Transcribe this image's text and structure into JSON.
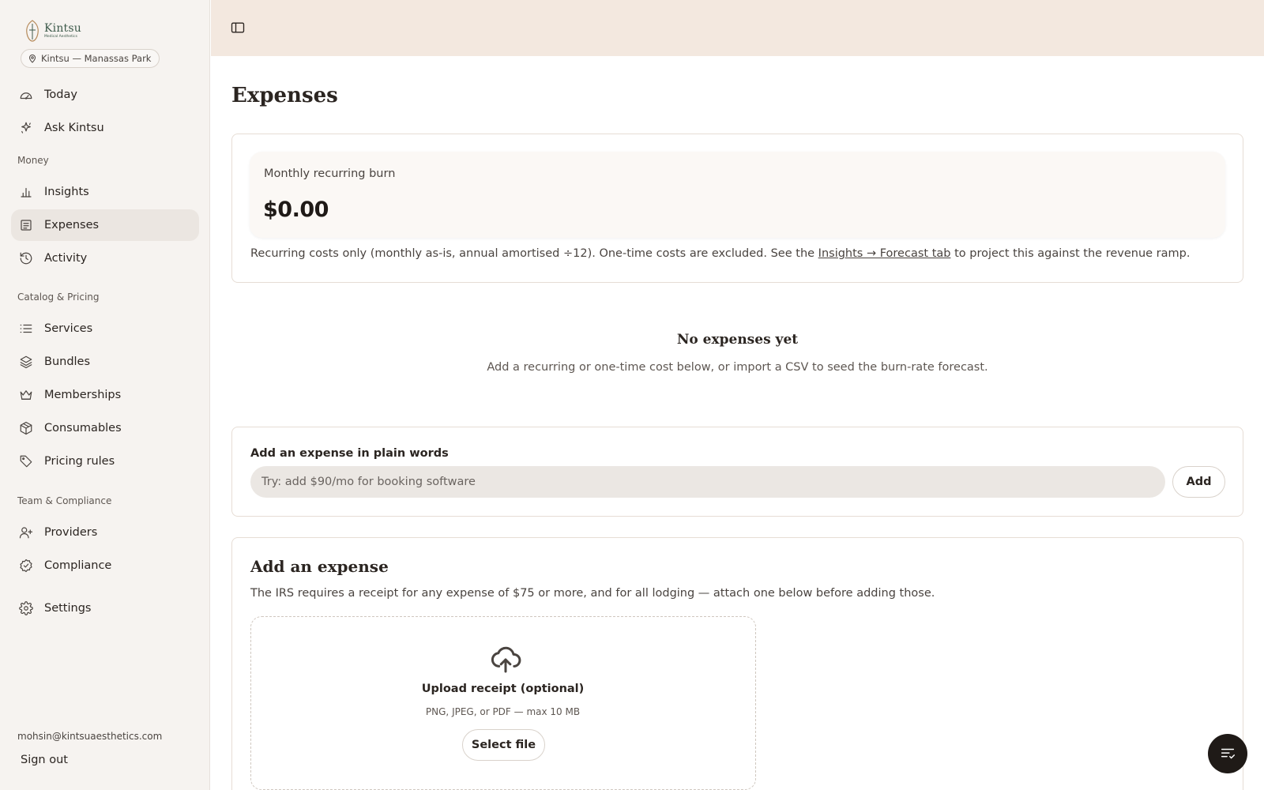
{
  "brand": {
    "name": "Kintsu",
    "subtitle": "Medical Aesthetics",
    "accent": "#3d5a4a"
  },
  "location": {
    "label": "Kintsu — Manassas Park",
    "icon": "map-pin-icon"
  },
  "sidebar": {
    "top_items": [
      {
        "label": "Today",
        "icon": "gauge-icon"
      },
      {
        "label": "Ask Kintsu",
        "icon": "sparkle-icon"
      }
    ],
    "sections": [
      {
        "title": "Money",
        "items": [
          {
            "label": "Insights",
            "icon": "bar-chart-icon"
          },
          {
            "label": "Expenses",
            "icon": "receipt-icon",
            "active": true
          },
          {
            "label": "Activity",
            "icon": "history-icon"
          }
        ]
      },
      {
        "title": "Catalog & Pricing",
        "items": [
          {
            "label": "Services",
            "icon": "list-icon"
          },
          {
            "label": "Bundles",
            "icon": "layers-icon"
          },
          {
            "label": "Memberships",
            "icon": "crown-icon"
          },
          {
            "label": "Consumables",
            "icon": "package-icon"
          },
          {
            "label": "Pricing rules",
            "icon": "tag-icon"
          }
        ]
      },
      {
        "title": "Team & Compliance",
        "items": [
          {
            "label": "Providers",
            "icon": "user-plus-icon"
          },
          {
            "label": "Compliance",
            "icon": "badge-check-icon"
          }
        ]
      }
    ],
    "settings": {
      "label": "Settings",
      "icon": "gear-icon"
    },
    "user_email": "mohsin@kintsuaesthetics.com",
    "sign_out": "Sign out"
  },
  "page": {
    "title": "Expenses"
  },
  "burn": {
    "label": "Monthly recurring burn",
    "value": "$0.00",
    "note_before": "Recurring costs only (monthly as-is, annual amortised ÷12). One-time costs are excluded. See the ",
    "note_link": "Insights → Forecast tab",
    "note_after": " to project this against the revenue ramp."
  },
  "empty": {
    "title": "No expenses yet",
    "subtitle": "Add a recurring or one-time cost below, or import a CSV to seed the burn-rate forecast."
  },
  "plain_words": {
    "label": "Add an expense in plain words",
    "placeholder": "Try: add $90/mo for booking software",
    "value": "",
    "button": "Add"
  },
  "add_expense": {
    "title": "Add an expense",
    "note": "The IRS requires a receipt for any expense of $75 or more, and for all lodging — attach one below before adding those.",
    "upload_title": "Upload receipt (optional)",
    "upload_sub": "PNG, JPEG, or PDF — max 10 MB",
    "select_button": "Select file"
  },
  "fab": {
    "icon": "filter-lines-icon"
  }
}
